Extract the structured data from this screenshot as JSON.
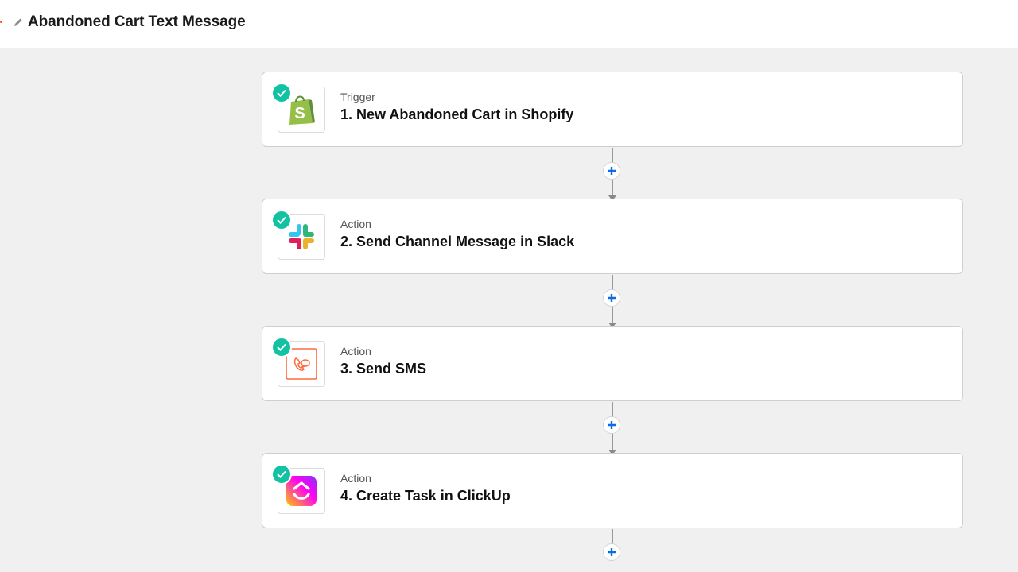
{
  "header": {
    "zap_title": "Abandoned Cart Text Message"
  },
  "colors": {
    "check_badge": "#13c2a3",
    "plus_blue": "#0e6cde",
    "accent": "#ff4f00"
  },
  "steps": [
    {
      "type": "Trigger",
      "title": "1. New Abandoned Cart in Shopify",
      "icon": "shopify-icon"
    },
    {
      "type": "Action",
      "title": "2. Send Channel Message in Slack",
      "icon": "slack-icon"
    },
    {
      "type": "Action",
      "title": "3. Send SMS",
      "icon": "sms-icon"
    },
    {
      "type": "Action",
      "title": "4. Create Task in ClickUp",
      "icon": "clickup-icon"
    }
  ],
  "icons": {
    "edit": "pencil-icon",
    "status": "check-icon",
    "add_step": "plus-icon"
  }
}
